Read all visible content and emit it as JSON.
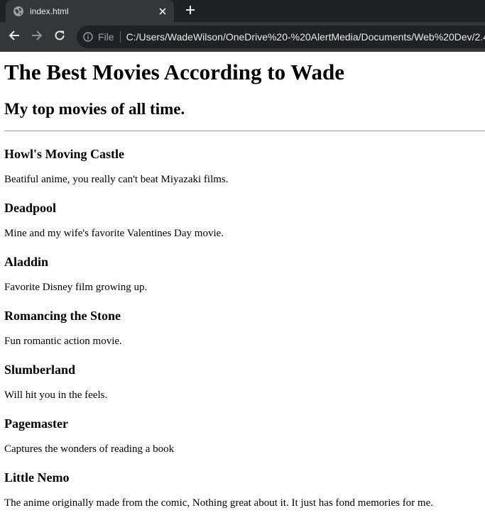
{
  "browser": {
    "tab_title": "index.html",
    "address_scheme": "File",
    "address_url": "C:/Users/WadeWilson/OneDrive%20-%20AlertMedia/Documents/Web%20Dev/2.4"
  },
  "page": {
    "title": "The Best Movies According to Wade",
    "subtitle": "My top movies of all time.",
    "movies": [
      {
        "title": "Howl's Moving Castle",
        "description": "Beatiful anime, you really can't beat Miyazaki films."
      },
      {
        "title": "Deadpool",
        "description": "Mine and my wife's favorite Valentines Day movie."
      },
      {
        "title": "Aladdin",
        "description": "Favorite Disney film growing up."
      },
      {
        "title": "Romancing the Stone",
        "description": "Fun romantic action movie."
      },
      {
        "title": "Slumberland",
        "description": "Will hit you in the feels."
      },
      {
        "title": "Pagemaster",
        "description": "Captures the wonders of reading a book"
      },
      {
        "title": "Little Nemo",
        "description": "The anime originally made from the comic, Nothing great about it. It just has fond memories for me."
      }
    ]
  },
  "icons": {
    "tab_favicon": "globe-icon",
    "tab_close": "close-icon",
    "new_tab": "plus-icon",
    "back": "arrow-left-icon",
    "forward": "arrow-right-icon",
    "reload": "reload-icon",
    "site_info": "info-icon"
  },
  "colors": {
    "tabbar_bg": "#202124",
    "active_tab_bg": "#35363a",
    "omnibox_bg": "#202124",
    "browser_text": "#e8eaed",
    "page_bg": "#ffffff",
    "page_text": "#000000"
  }
}
